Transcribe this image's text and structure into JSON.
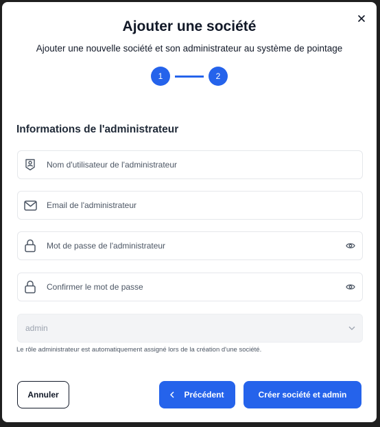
{
  "dialog": {
    "title": "Ajouter une société",
    "subtitle": "Ajouter une nouvelle société et son administrateur au système de pointage",
    "close_icon": "close-icon"
  },
  "stepper": {
    "steps": [
      "1",
      "2"
    ],
    "current": 2,
    "color": "#2563eb"
  },
  "section": {
    "title": "Informations de l'administrateur"
  },
  "fields": {
    "username": {
      "placeholder": "Nom d'utilisateur de l'administrateur",
      "value": "",
      "icon": "badge-icon"
    },
    "email": {
      "placeholder": "Email de l'administrateur",
      "value": "",
      "icon": "mail-icon"
    },
    "password": {
      "placeholder": "Mot de passe de l'administrateur",
      "value": "",
      "icon": "lock-icon",
      "toggle_icon": "eye-icon"
    },
    "confirm": {
      "placeholder": "Confirmer le mot de passe",
      "value": "",
      "icon": "lock-icon",
      "toggle_icon": "eye-icon"
    }
  },
  "role": {
    "value": "admin",
    "hint": "Le rôle administrateur est automatiquement assigné lors de la création d'une société."
  },
  "buttons": {
    "cancel": "Annuler",
    "previous": "Précédent",
    "create": "Créer société et admin"
  },
  "colors": {
    "accent": "#2563eb",
    "overlay": "#1f1f1f"
  }
}
